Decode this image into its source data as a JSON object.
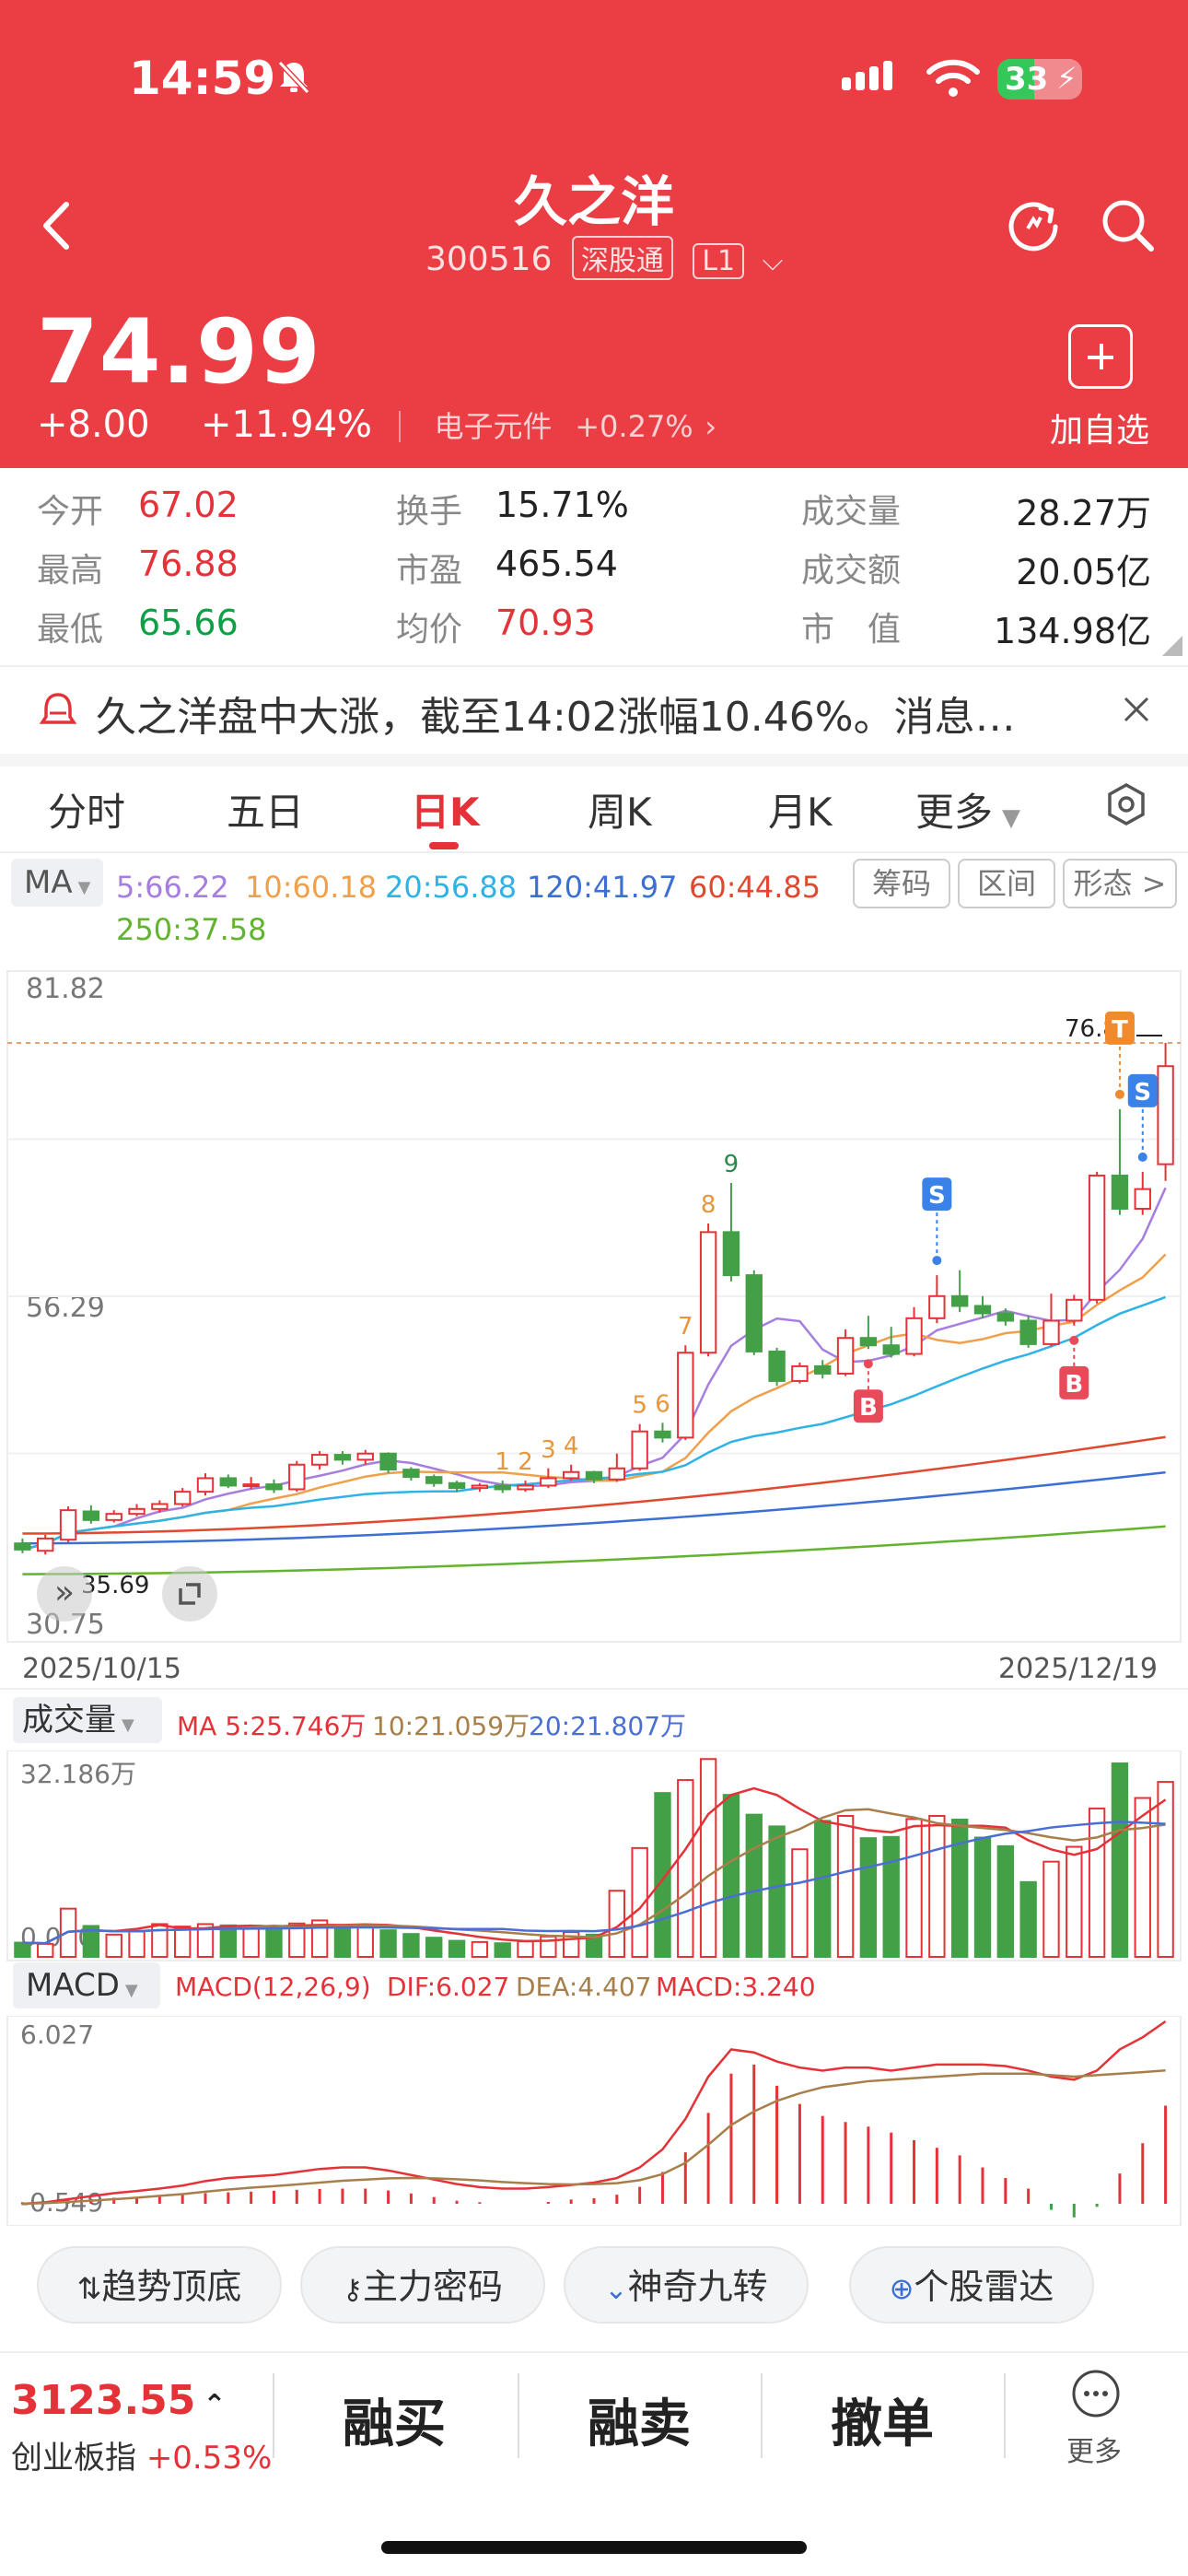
{
  "status_bar": {
    "time": "14:59",
    "battery": "33"
  },
  "header": {
    "title": "久之洋",
    "code": "300516",
    "market_tag": "深股通",
    "level_tag": "L1",
    "price": "74.99",
    "change": "+8.00",
    "change_pct": "+11.94%",
    "sector": "电子元件",
    "sector_change": "+0.27%",
    "add_watch_label": "加自选"
  },
  "stats": {
    "open_label": "今开",
    "open": "67.02",
    "high_label": "最高",
    "high": "76.88",
    "low_label": "最低",
    "low": "65.66",
    "turnover_label": "换手",
    "turnover": "15.71%",
    "pe_label": "市盈",
    "pe": "465.54",
    "avg_label": "均价",
    "avg": "70.93",
    "volume_label": "成交量",
    "volume": "28.27万",
    "amount_label": "成交额",
    "amount": "20.05亿",
    "mcap_label": "市　值",
    "mcap": "134.98亿"
  },
  "banner": {
    "text": "久之洋盘中大涨，截至14:02涨幅10.46%。消息…"
  },
  "tabs": [
    "分时",
    "五日",
    "日K",
    "周K",
    "月K",
    "更多"
  ],
  "active_tab": "日K",
  "ma_legend": {
    "selector": "MA",
    "items": [
      {
        "label": "5:66.22",
        "color": "#a77ee0"
      },
      {
        "label": "10:60.18",
        "color": "#f0a04b"
      },
      {
        "label": "20:56.88",
        "color": "#2fb3e6"
      },
      {
        "label": "120:41.97",
        "color": "#3b6fd4"
      },
      {
        "label": "60:44.85",
        "color": "#e0482f"
      },
      {
        "label": "250:37.58",
        "color": "#62b32f"
      }
    ],
    "buttons": [
      "筹码",
      "区间",
      "形态 >"
    ]
  },
  "chart_data": [
    {
      "type": "candlestick",
      "title": "",
      "y_max_label": "81.82",
      "y_mid_label": "56.29",
      "y_min_label": "30.75",
      "ylim": [
        30.75,
        81.82
      ],
      "x_start": "2025/10/15",
      "x_end": "2025/12/19",
      "high_label": "76.88",
      "low_label": "35.69",
      "candles": [
        [
          36.2,
          35.7,
          36.6,
          35.4
        ],
        [
          35.6,
          36.6,
          36.9,
          35.3
        ],
        [
          36.5,
          38.9,
          39.2,
          36.3
        ],
        [
          38.8,
          38.1,
          39.3,
          37.8
        ],
        [
          38.1,
          38.6,
          38.9,
          37.9
        ],
        [
          38.6,
          39.0,
          39.4,
          38.4
        ],
        [
          39.0,
          39.4,
          39.7,
          38.7
        ],
        [
          39.4,
          40.4,
          40.7,
          39.2
        ],
        [
          40.4,
          41.5,
          41.9,
          40.1
        ],
        [
          41.5,
          40.9,
          41.8,
          40.7
        ],
        [
          40.9,
          41.0,
          41.6,
          40.6
        ],
        [
          41.0,
          40.6,
          41.4,
          40.3
        ],
        [
          40.6,
          42.6,
          42.9,
          40.4
        ],
        [
          42.6,
          43.4,
          43.7,
          42.2
        ],
        [
          43.4,
          43.0,
          43.7,
          42.6
        ],
        [
          43.0,
          43.5,
          43.8,
          42.6
        ],
        [
          43.5,
          42.2,
          43.6,
          41.9
        ],
        [
          42.2,
          41.6,
          42.4,
          41.3
        ],
        [
          41.6,
          41.1,
          41.8,
          40.8
        ],
        [
          41.1,
          40.7,
          41.3,
          40.4
        ],
        [
          40.7,
          40.9,
          41.1,
          40.4
        ],
        [
          40.9,
          40.6,
          41.3,
          40.3
        ],
        [
          40.6,
          40.9,
          41.3,
          40.4
        ],
        [
          40.9,
          41.5,
          42.3,
          40.7
        ],
        [
          41.5,
          42.0,
          42.6,
          41.3
        ],
        [
          42.0,
          41.4,
          42.1,
          41.1
        ],
        [
          41.4,
          42.3,
          43.5,
          41.2
        ],
        [
          42.3,
          45.3,
          45.9,
          42.1
        ],
        [
          45.3,
          44.8,
          46.0,
          44.4
        ],
        [
          44.8,
          51.7,
          52.3,
          44.6
        ],
        [
          51.7,
          61.5,
          62.2,
          51.4
        ],
        [
          61.5,
          58.0,
          65.5,
          57.5
        ],
        [
          58.0,
          51.8,
          58.4,
          51.5
        ],
        [
          51.8,
          49.4,
          52.1,
          49.0
        ],
        [
          49.4,
          50.6,
          50.9,
          49.2
        ],
        [
          50.6,
          50.0,
          51.1,
          49.6
        ],
        [
          50.0,
          52.9,
          53.6,
          49.8
        ],
        [
          52.9,
          52.3,
          54.7,
          52.0
        ],
        [
          52.3,
          51.6,
          53.8,
          51.3
        ],
        [
          51.6,
          54.5,
          55.4,
          51.4
        ],
        [
          54.5,
          56.3,
          58.0,
          54.1
        ],
        [
          56.3,
          55.5,
          58.4,
          55.0
        ],
        [
          55.5,
          54.9,
          56.3,
          54.5
        ],
        [
          54.9,
          54.3,
          55.3,
          53.9
        ],
        [
          54.3,
          52.4,
          54.7,
          52.1
        ],
        [
          52.4,
          54.3,
          56.5,
          52.2
        ],
        [
          54.3,
          56.0,
          56.4,
          53.9
        ],
        [
          56.0,
          66.1,
          66.4,
          55.7
        ],
        [
          66.1,
          63.4,
          71.5,
          62.9
        ],
        [
          63.4,
          65.0,
          66.4,
          62.9
        ],
        [
          67.02,
          74.99,
          76.88,
          65.66
        ]
      ],
      "markers": [
        "1",
        "2",
        "3",
        "4",
        "5",
        "6",
        "7",
        "8",
        "9",
        "S",
        "B",
        "S",
        "T",
        "B"
      ]
    },
    {
      "type": "bar",
      "title": "成交量",
      "ma_legend": [
        {
          "label": "MA 5:25.746万",
          "color": "#e53238"
        },
        {
          "label": "10:21.059万",
          "color": "#a87f4a"
        },
        {
          "label": "20:21.807万",
          "color": "#4a6fd4"
        }
      ],
      "y_max_label": "32.186万",
      "y_min_label": "0.000",
      "values": [
        2.3,
        2.1,
        7.8,
        5.0,
        3.6,
        4.1,
        5.3,
        4.9,
        5.3,
        5.1,
        4.6,
        4.8,
        5.4,
        5.9,
        5.1,
        5.1,
        4.3,
        3.7,
        3.1,
        2.6,
        2.4,
        2.2,
        2.5,
        3.3,
        4.0,
        3.6,
        10.7,
        17.6,
        26.5,
        28.6,
        32.0,
        26.2,
        23.0,
        21.1,
        17.4,
        22.0,
        22.8,
        19.2,
        19.4,
        22.3,
        22.8,
        22.2,
        19.3,
        17.9,
        12.1,
        15.4,
        17.8,
        24.0,
        31.3,
        25.7,
        28.3
      ]
    },
    {
      "type": "bar",
      "title": "MACD",
      "params": "MACD(12,26,9)",
      "dif_label": "DIF:6.027",
      "dea_label": "DEA:4.407",
      "macd_label": "MACD:3.240",
      "y_max_label": "6.027",
      "y_min_label": "-0.549",
      "hist": [
        0.05,
        0.05,
        0.12,
        0.16,
        0.2,
        0.22,
        0.26,
        0.3,
        0.35,
        0.38,
        0.4,
        0.43,
        0.46,
        0.49,
        0.5,
        0.5,
        0.44,
        0.34,
        0.22,
        0.1,
        0.05,
        0.0,
        0.0,
        0.06,
        0.14,
        0.18,
        0.3,
        0.56,
        1.05,
        1.7,
        3.0,
        4.3,
        4.6,
        3.9,
        3.3,
        2.9,
        2.7,
        2.55,
        2.35,
        2.1,
        1.85,
        1.6,
        1.2,
        0.85,
        0.5,
        -0.2,
        -0.45,
        -0.1,
        1.0,
        2.0,
        3.24
      ],
      "dif": [
        0.0,
        0.05,
        0.15,
        0.25,
        0.35,
        0.42,
        0.5,
        0.6,
        0.75,
        0.85,
        0.9,
        0.95,
        1.05,
        1.15,
        1.2,
        1.2,
        1.1,
        0.95,
        0.8,
        0.65,
        0.55,
        0.5,
        0.5,
        0.55,
        0.62,
        0.7,
        0.85,
        1.2,
        1.8,
        2.8,
        4.2,
        5.1,
        5.0,
        4.7,
        4.5,
        4.4,
        4.5,
        4.5,
        4.4,
        4.5,
        4.6,
        4.6,
        4.6,
        4.55,
        4.4,
        4.2,
        4.1,
        4.4,
        5.1,
        5.5,
        6.027
      ],
      "dea": [
        0.0,
        0.02,
        0.06,
        0.1,
        0.15,
        0.2,
        0.26,
        0.32,
        0.4,
        0.47,
        0.53,
        0.58,
        0.64,
        0.7,
        0.76,
        0.8,
        0.84,
        0.85,
        0.84,
        0.81,
        0.77,
        0.72,
        0.68,
        0.65,
        0.64,
        0.65,
        0.68,
        0.78,
        0.98,
        1.35,
        1.95,
        2.6,
        3.05,
        3.4,
        3.65,
        3.85,
        3.95,
        4.05,
        4.1,
        4.15,
        4.2,
        4.25,
        4.3,
        4.3,
        4.3,
        4.25,
        4.2,
        4.25,
        4.3,
        4.35,
        4.407
      ]
    }
  ],
  "tools": [
    "趋势顶底",
    "主力密码",
    "神奇九转",
    "个股雷达"
  ],
  "bottom_bar": {
    "index_value": "3123.55",
    "index_name": "创业板指",
    "index_change": "+0.53%",
    "buttons": [
      "融买",
      "融卖",
      "撤单"
    ],
    "more_label": "更多"
  }
}
